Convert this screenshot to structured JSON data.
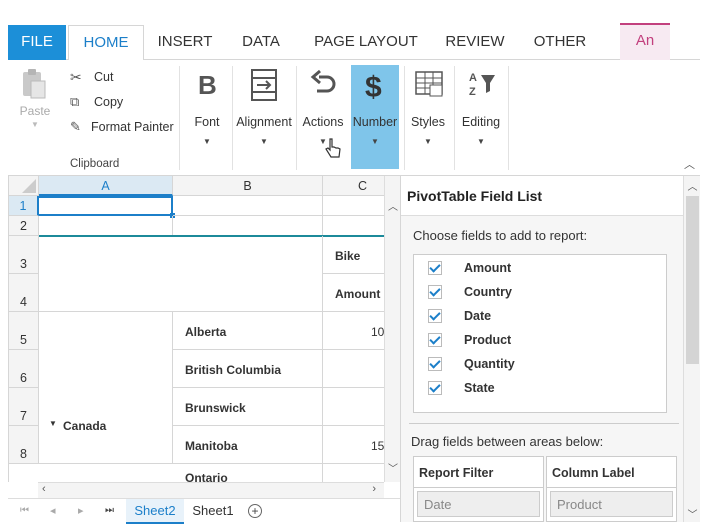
{
  "tabs": [
    "FILE",
    "HOME",
    "INSERT",
    "DATA",
    "PAGE LAYOUT",
    "REVIEW",
    "OTHER",
    "An"
  ],
  "ribbon": {
    "paste": "Paste",
    "cut": "Cut",
    "copy": "Copy",
    "format_painter": "Format Painter",
    "clipboard_group": "Clipboard",
    "font": "Font",
    "alignment": "Alignment",
    "actions": "Actions",
    "number": "Number",
    "styles": "Styles",
    "editing": "Editing"
  },
  "grid": {
    "columns": [
      "A",
      "B",
      "C"
    ],
    "rows": [
      "1",
      "2",
      "3",
      "4",
      "5",
      "6",
      "7",
      "8"
    ],
    "pivot_cells": {
      "bike": "Bike",
      "amount": "Amount",
      "country": "Canada",
      "alberta": "Alberta",
      "bc": "British Columbia",
      "brunswick": "Brunswick",
      "manitoba": "Manitoba",
      "ontario": "Ontario",
      "val5": "10",
      "val8": "15"
    }
  },
  "sheets": [
    "Sheet2",
    "Sheet1"
  ],
  "pivot": {
    "title": "PivotTable Field List",
    "choose": "Choose fields to add to report:",
    "fields": [
      "Amount",
      "Country",
      "Date",
      "Product",
      "Quantity",
      "State"
    ],
    "drag": "Drag fields between areas below:",
    "report_filter": "Report Filter",
    "column_label": "Column Label",
    "filter_item": "Date",
    "column_item": "Product"
  }
}
